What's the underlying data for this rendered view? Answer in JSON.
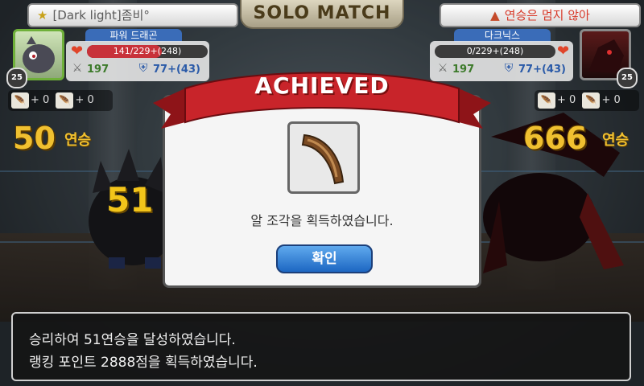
{
  "left_player": {
    "guild_name": "[Dark light]좀비°",
    "character_name": "파워 드래곤",
    "hp_text": "141/229+(248)",
    "attack": "197",
    "defense": "77+(43)",
    "level": "25",
    "item1_count": "+ 0",
    "item2_count": "+ 0",
    "streak_number": "50",
    "streak_suffix": "연승",
    "hp_fraction": 0.62
  },
  "header": {
    "title": "SOLO MATCH"
  },
  "right_player": {
    "status_name": "연승은 멈지 않아",
    "character_name": "다크닉스",
    "hp_text": "0/229+(248)",
    "attack": "197",
    "defense": "77+(43)",
    "level": "25",
    "item1_count": "+ 0",
    "item2_count": "+ 0",
    "streak_number": "666",
    "streak_suffix": "연승",
    "hp_fraction": 0.0
  },
  "battle": {
    "combo_number": "51"
  },
  "modal": {
    "banner": "ACHIEVED",
    "message": "알 조각을 획득하였습니다.",
    "confirm_label": "확인"
  },
  "message_box": {
    "line1": "승리하여 51연승을 달성하였습니다.",
    "line2": "랭킹 포인트 2888점을 획득하였습니다."
  },
  "colors": {
    "ribbon": "#c8242a",
    "streak": "#f0c030",
    "button_blue": "#1d67c2"
  }
}
